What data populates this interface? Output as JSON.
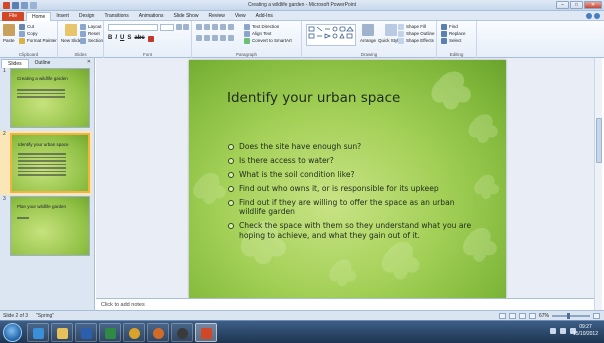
{
  "window": {
    "title": "Creating a wildlife garden - Microsoft PowerPoint"
  },
  "ribbon": {
    "file_tab": "File",
    "tabs": [
      "Home",
      "Insert",
      "Design",
      "Transitions",
      "Animations",
      "Slide Show",
      "Review",
      "View",
      "Add-Ins"
    ],
    "active_tab": "Home",
    "clipboard": {
      "paste": "Paste",
      "cut": "Cut",
      "copy": "Copy",
      "format_painter": "Format Painter",
      "group": "Clipboard"
    },
    "slides": {
      "new_slide": "New Slide",
      "layout": "Layout",
      "reset": "Reset",
      "section": "Section",
      "group": "Slides"
    },
    "font": {
      "group": "Font"
    },
    "paragraph": {
      "text_direction": "Text Direction",
      "align_text": "Align Text",
      "convert_smartart": "Convert to SmartArt",
      "group": "Paragraph"
    },
    "drawing": {
      "arrange": "Arrange",
      "quick_styles": "Quick Styles",
      "shape_fill": "Shape Fill",
      "shape_outline": "Shape Outline",
      "shape_effects": "Shape Effects",
      "group": "Drawing"
    },
    "editing": {
      "find": "Find",
      "replace": "Replace",
      "select": "Select",
      "group": "Editing"
    }
  },
  "panel": {
    "tabs": [
      "Slides",
      "Outline"
    ],
    "active_tab": "Slides",
    "thumbnails": [
      {
        "number": "1",
        "title": "Creating a wildlife garden",
        "lines": 3
      },
      {
        "number": "2",
        "title": "Identify your urban space",
        "lines": 7
      },
      {
        "number": "3",
        "title": "Plan your wildlife garden",
        "lines": 1
      }
    ],
    "selected_index": 1
  },
  "slide": {
    "title": "Identify your urban space",
    "bullets": [
      "Does the site have enough sun?",
      "Is there access to water?",
      "What is the soil condition like?",
      "Find out who owns it, or is responsible for its upkeep",
      "Find out if they are willing to offer the space as an urban wildlife garden",
      "Check the space with them so they understand what you are hoping to achieve, and what they gain out of it."
    ]
  },
  "notes": {
    "placeholder": "Click to add notes"
  },
  "status": {
    "slide_info": "Slide 2 of 3",
    "theme": "\"Spring\"",
    "zoom": "67%"
  },
  "taskbar": {
    "time": "09:27",
    "date": "15/10/2012"
  },
  "colors": {
    "file_tab": "#d24726",
    "slide_green": "#a3d057",
    "selection": "#f3b43f"
  }
}
